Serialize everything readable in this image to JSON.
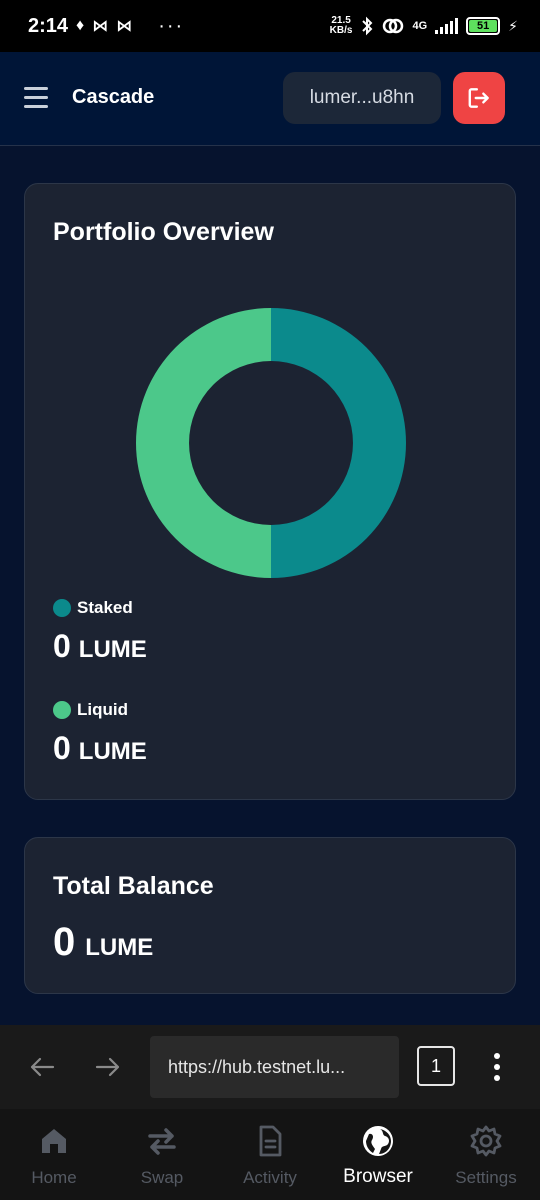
{
  "status_bar": {
    "time": "2:14",
    "net_speed_value": "21.5",
    "net_speed_unit": "KB/s",
    "net_type": "4G",
    "battery": "51",
    "dots": "···"
  },
  "header": {
    "title": "Cascade",
    "wallet_address": "lumer...u8hn"
  },
  "portfolio": {
    "title": "Portfolio Overview",
    "staked_label": "Staked",
    "staked_value": "0",
    "liquid_label": "Liquid",
    "liquid_value": "0",
    "unit": "LUME"
  },
  "chart_data": {
    "type": "pie",
    "categories": [
      "Staked",
      "Liquid"
    ],
    "values": [
      50,
      50
    ],
    "colors": [
      "#0b8a8c",
      "#4cc88a"
    ],
    "donut": true
  },
  "balance": {
    "title": "Total Balance",
    "value": "0",
    "unit": "LUME"
  },
  "browser": {
    "url": "https://hub.testnet.lu...",
    "tab_count": "1"
  },
  "bottom_nav": {
    "items": [
      {
        "label": "Home"
      },
      {
        "label": "Swap"
      },
      {
        "label": "Activity"
      },
      {
        "label": "Browser"
      },
      {
        "label": "Settings"
      }
    ]
  },
  "colors": {
    "accent_teal": "#0b8a8c",
    "accent_green": "#4cc88a",
    "logout_red": "#ef4444",
    "header_bg": "#001537",
    "card_bg": "#1c2332"
  }
}
